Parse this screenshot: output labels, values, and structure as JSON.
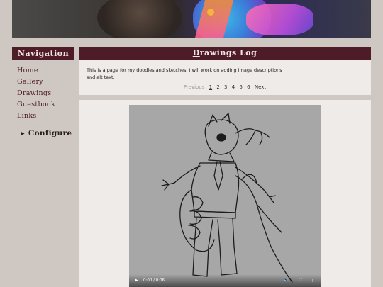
{
  "banner": {
    "alt": "banner image"
  },
  "nav": {
    "header_first": "N",
    "header_rest": "avigation",
    "items": [
      {
        "label": "Home"
      },
      {
        "label": "Gallery"
      },
      {
        "label": "Drawings"
      },
      {
        "label": "Guestbook"
      },
      {
        "label": "Links"
      }
    ],
    "configure_label": "Configure",
    "configure_icon": "triangle-right-icon"
  },
  "log": {
    "header_first": "D",
    "header_rest": "rawings Log",
    "description": "This is a page for my doodles and sketches. I will work on adding image descriptions and alt text.",
    "pager": {
      "previous": "Previous",
      "pages": [
        "1",
        "2",
        "3",
        "4",
        "5",
        "6"
      ],
      "current": "1",
      "next": "Next"
    }
  },
  "video": {
    "time": "0:00 / 0:06",
    "play_icon": "play-icon",
    "volume_icon": "volume-icon",
    "fullscreen_icon": "fullscreen-icon",
    "more_icon": "more-vertical-icon"
  },
  "colors": {
    "header_bg": "#4e1c27",
    "page_bg": "#cfc8c2",
    "panel_bg": "#efebe8",
    "video_bg": "#a7a7a7"
  }
}
